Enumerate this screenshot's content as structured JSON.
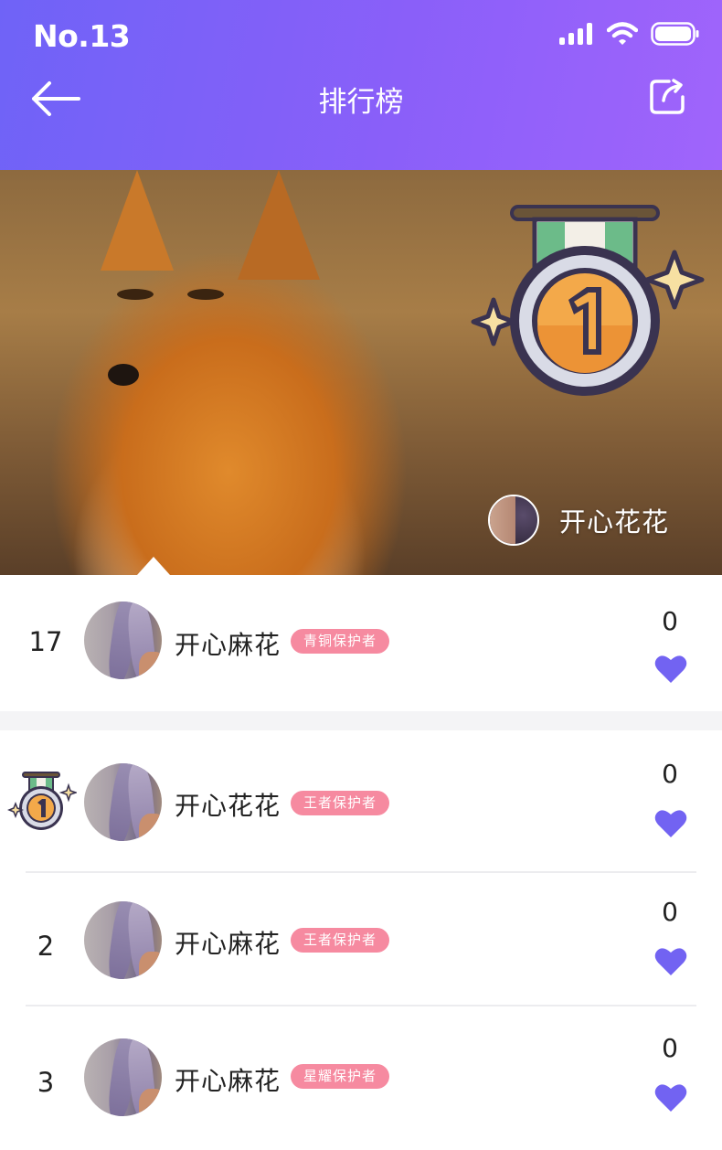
{
  "status_bar": {
    "time": "No.13"
  },
  "nav": {
    "title": "排行榜"
  },
  "hero": {
    "top_user_name": "开心花花"
  },
  "my_rank": {
    "rank": "17",
    "name": "开心麻花",
    "badge": "青铜保护者",
    "count": "0"
  },
  "ranking": [
    {
      "rank": "",
      "medal": "gold-medal",
      "name": "开心花花",
      "badge": "王者保护者",
      "count": "0"
    },
    {
      "rank": "2",
      "name": "开心麻花",
      "badge": "王者保护者",
      "count": "0"
    },
    {
      "rank": "3",
      "name": "开心麻花",
      "badge": "星耀保护者",
      "count": "0"
    }
  ],
  "colors": {
    "header_start": "#6f63f7",
    "header_end": "#a064fb",
    "heart": "#7263f2",
    "badge": "#f68aa0"
  }
}
